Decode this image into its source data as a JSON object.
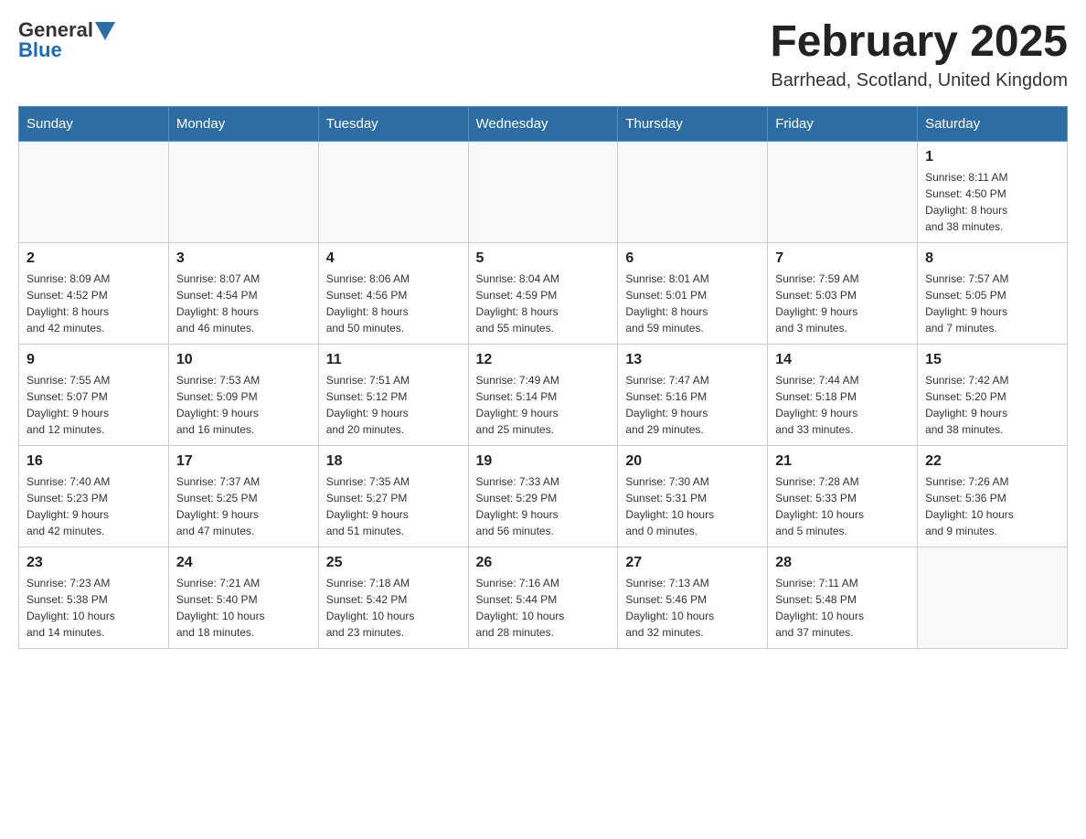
{
  "header": {
    "logo": {
      "text_general": "General",
      "text_blue": "Blue"
    },
    "title": "February 2025",
    "location": "Barrhead, Scotland, United Kingdom"
  },
  "days_of_week": [
    "Sunday",
    "Monday",
    "Tuesday",
    "Wednesday",
    "Thursday",
    "Friday",
    "Saturday"
  ],
  "weeks": [
    {
      "days": [
        {
          "number": "",
          "info": ""
        },
        {
          "number": "",
          "info": ""
        },
        {
          "number": "",
          "info": ""
        },
        {
          "number": "",
          "info": ""
        },
        {
          "number": "",
          "info": ""
        },
        {
          "number": "",
          "info": ""
        },
        {
          "number": "1",
          "info": "Sunrise: 8:11 AM\nSunset: 4:50 PM\nDaylight: 8 hours\nand 38 minutes."
        }
      ]
    },
    {
      "days": [
        {
          "number": "2",
          "info": "Sunrise: 8:09 AM\nSunset: 4:52 PM\nDaylight: 8 hours\nand 42 minutes."
        },
        {
          "number": "3",
          "info": "Sunrise: 8:07 AM\nSunset: 4:54 PM\nDaylight: 8 hours\nand 46 minutes."
        },
        {
          "number": "4",
          "info": "Sunrise: 8:06 AM\nSunset: 4:56 PM\nDaylight: 8 hours\nand 50 minutes."
        },
        {
          "number": "5",
          "info": "Sunrise: 8:04 AM\nSunset: 4:59 PM\nDaylight: 8 hours\nand 55 minutes."
        },
        {
          "number": "6",
          "info": "Sunrise: 8:01 AM\nSunset: 5:01 PM\nDaylight: 8 hours\nand 59 minutes."
        },
        {
          "number": "7",
          "info": "Sunrise: 7:59 AM\nSunset: 5:03 PM\nDaylight: 9 hours\nand 3 minutes."
        },
        {
          "number": "8",
          "info": "Sunrise: 7:57 AM\nSunset: 5:05 PM\nDaylight: 9 hours\nand 7 minutes."
        }
      ]
    },
    {
      "days": [
        {
          "number": "9",
          "info": "Sunrise: 7:55 AM\nSunset: 5:07 PM\nDaylight: 9 hours\nand 12 minutes."
        },
        {
          "number": "10",
          "info": "Sunrise: 7:53 AM\nSunset: 5:09 PM\nDaylight: 9 hours\nand 16 minutes."
        },
        {
          "number": "11",
          "info": "Sunrise: 7:51 AM\nSunset: 5:12 PM\nDaylight: 9 hours\nand 20 minutes."
        },
        {
          "number": "12",
          "info": "Sunrise: 7:49 AM\nSunset: 5:14 PM\nDaylight: 9 hours\nand 25 minutes."
        },
        {
          "number": "13",
          "info": "Sunrise: 7:47 AM\nSunset: 5:16 PM\nDaylight: 9 hours\nand 29 minutes."
        },
        {
          "number": "14",
          "info": "Sunrise: 7:44 AM\nSunset: 5:18 PM\nDaylight: 9 hours\nand 33 minutes."
        },
        {
          "number": "15",
          "info": "Sunrise: 7:42 AM\nSunset: 5:20 PM\nDaylight: 9 hours\nand 38 minutes."
        }
      ]
    },
    {
      "days": [
        {
          "number": "16",
          "info": "Sunrise: 7:40 AM\nSunset: 5:23 PM\nDaylight: 9 hours\nand 42 minutes."
        },
        {
          "number": "17",
          "info": "Sunrise: 7:37 AM\nSunset: 5:25 PM\nDaylight: 9 hours\nand 47 minutes."
        },
        {
          "number": "18",
          "info": "Sunrise: 7:35 AM\nSunset: 5:27 PM\nDaylight: 9 hours\nand 51 minutes."
        },
        {
          "number": "19",
          "info": "Sunrise: 7:33 AM\nSunset: 5:29 PM\nDaylight: 9 hours\nand 56 minutes."
        },
        {
          "number": "20",
          "info": "Sunrise: 7:30 AM\nSunset: 5:31 PM\nDaylight: 10 hours\nand 0 minutes."
        },
        {
          "number": "21",
          "info": "Sunrise: 7:28 AM\nSunset: 5:33 PM\nDaylight: 10 hours\nand 5 minutes."
        },
        {
          "number": "22",
          "info": "Sunrise: 7:26 AM\nSunset: 5:36 PM\nDaylight: 10 hours\nand 9 minutes."
        }
      ]
    },
    {
      "days": [
        {
          "number": "23",
          "info": "Sunrise: 7:23 AM\nSunset: 5:38 PM\nDaylight: 10 hours\nand 14 minutes."
        },
        {
          "number": "24",
          "info": "Sunrise: 7:21 AM\nSunset: 5:40 PM\nDaylight: 10 hours\nand 18 minutes."
        },
        {
          "number": "25",
          "info": "Sunrise: 7:18 AM\nSunset: 5:42 PM\nDaylight: 10 hours\nand 23 minutes."
        },
        {
          "number": "26",
          "info": "Sunrise: 7:16 AM\nSunset: 5:44 PM\nDaylight: 10 hours\nand 28 minutes."
        },
        {
          "number": "27",
          "info": "Sunrise: 7:13 AM\nSunset: 5:46 PM\nDaylight: 10 hours\nand 32 minutes."
        },
        {
          "number": "28",
          "info": "Sunrise: 7:11 AM\nSunset: 5:48 PM\nDaylight: 10 hours\nand 37 minutes."
        },
        {
          "number": "",
          "info": ""
        }
      ]
    }
  ]
}
